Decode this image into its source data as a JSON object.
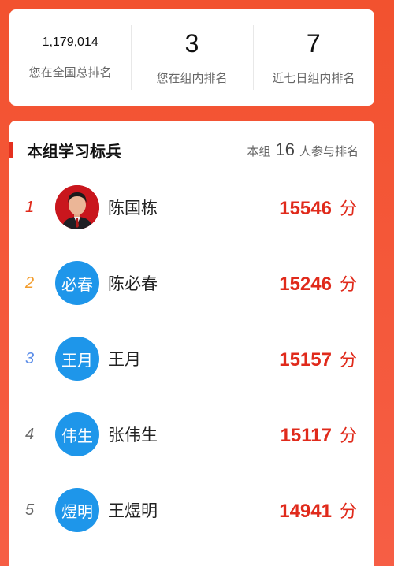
{
  "stats": [
    {
      "value": "1,179,014",
      "label": "您在全国总排名"
    },
    {
      "value": "3",
      "label": "您在组内排名"
    },
    {
      "value": "7",
      "label": "近七日组内排名"
    }
  ],
  "board": {
    "title": "本组学习标兵",
    "participants_prefix": "本组",
    "participants_count": "16",
    "participants_suffix": "人参与排名",
    "rows": [
      {
        "rank": "1",
        "rank_color": "#e02a1b",
        "avatar_text": "",
        "avatar_type": "photo",
        "name": "陈国栋",
        "score": "15546",
        "unit": "分"
      },
      {
        "rank": "2",
        "rank_color": "#f39c2b",
        "avatar_text": "必春",
        "avatar_type": "text",
        "name": "陈必春",
        "score": "15246",
        "unit": "分"
      },
      {
        "rank": "3",
        "rank_color": "#5b8de8",
        "avatar_text": "王月",
        "avatar_type": "text",
        "name": "王月",
        "score": "15157",
        "unit": "分"
      },
      {
        "rank": "4",
        "rank_color": "#666666",
        "avatar_text": "伟生",
        "avatar_type": "text",
        "name": "张伟生",
        "score": "15117",
        "unit": "分"
      },
      {
        "rank": "5",
        "rank_color": "#666666",
        "avatar_text": "煜明",
        "avatar_type": "text",
        "name": "王煜明",
        "score": "14941",
        "unit": "分"
      }
    ]
  },
  "colors": {
    "background": "#f4583a",
    "score": "#e02a1b",
    "avatar": "#1e96ea",
    "accent": "#e5301f"
  }
}
